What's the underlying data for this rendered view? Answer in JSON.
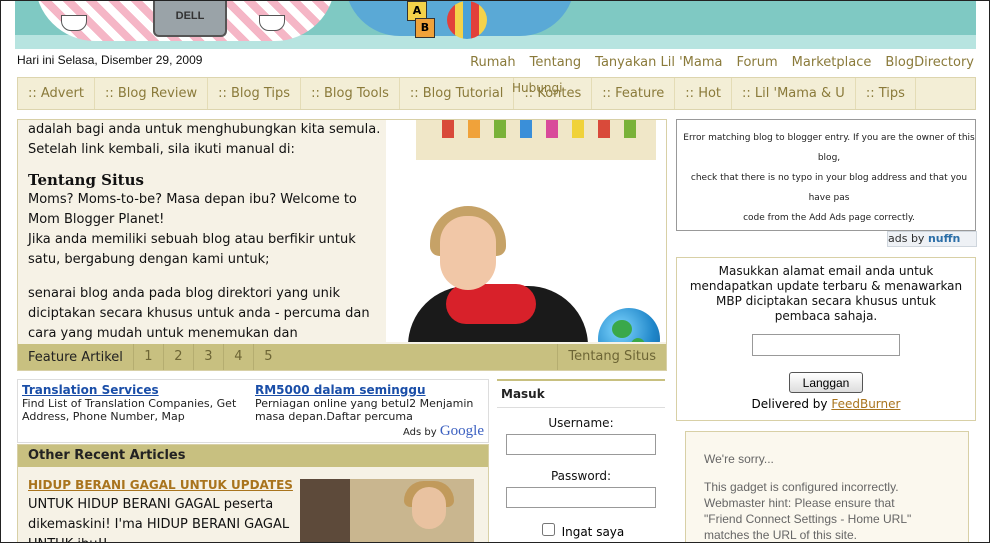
{
  "header": {
    "laptop_brand": "DELL",
    "blocks": [
      "A",
      "B"
    ],
    "date": "Hari ini Selasa, Disember 29, 2009"
  },
  "toplinks": [
    "Rumah",
    "Tentang",
    "Tanyakan Lil 'Mama",
    "Forum",
    "Marketplace",
    "BlogDirectory"
  ],
  "hubungi": "Hubungi",
  "nav": [
    ":: Advert",
    ":: Blog Review",
    ":: Blog Tips",
    ":: Blog Tools",
    ":: Blog Tutorial",
    ":: Kontes",
    ":: Feature",
    ":: Hot",
    ":: Lil 'Mama & U",
    ":: Tips"
  ],
  "feature": {
    "line1": "adalah bagi anda untuk menghubungkan kita semula.",
    "line2": "Setelah link kembali, sila ikuti manual di:",
    "heading": "Tentang Situs",
    "para1": "Moms? Moms-to-be? Masa depan ibu? Welcome to Mom Blogger Planet!",
    "para2": "Jika anda memiliki sebuah blog atau berfikir untuk satu, bergabung dengan kami untuk;",
    "para3": "senarai blog anda pada blog direktori yang unik diciptakan secara khusus untuk anda - percuma dan cara yang mudah untuk menemukan dan",
    "pager_label": "Feature Artikel",
    "pages": [
      "1",
      "2",
      "3",
      "4",
      "5"
    ],
    "pager_right": "Tentang Situs"
  },
  "ads": {
    "ad1_title": "Translation Services",
    "ad1_text": "Find List of Translation Companies, Get Address, Phone Number, Map",
    "ad2_title": "RM5000 dalam seminggu",
    "ad2_text": "Perniagan online yang betul2 Menjamin masa depan.Daftar percuma",
    "adsby": "Ads by",
    "google": "Google"
  },
  "recent": {
    "heading": "Other Recent Articles",
    "title": "HIDUP BERANI GAGAL UNTUK UPDATES",
    "body": "UNTUK HIDUP BERANI GAGAL peserta dikemaskini! I'ma HIDUP BERANI GAGAL UNTUK ibu!!"
  },
  "login": {
    "heading": "Masuk",
    "username_label": "Username:",
    "password_label": "Password:",
    "remember_label": "Ingat saya"
  },
  "errbox": {
    "line1": "Error matching blog to blogger entry. If you are the owner of this blog,",
    "line2": "check that there is no typo in your blog address and that you have pas",
    "line3": "code from the Add Ads page correctly."
  },
  "nuffnang": {
    "prefix": "ads by",
    "brand": "nuffn"
  },
  "subscribe": {
    "text": "Masukkan alamat email anda untuk mendapatkan update terbaru & menawarkan MBP diciptakan secara khusus untuk pembaca sahaja.",
    "button": "Langgan",
    "delivered": "Delivered by",
    "feedburner": "FeedBurner"
  },
  "sorry": {
    "title": "We're sorry...",
    "l1": "This gadget is configured incorrectly.",
    "l2": "Webmaster hint: Please ensure that",
    "l3": "\"Friend Connect Settings - Home URL\"",
    "l4": "matches the URL of this site."
  }
}
